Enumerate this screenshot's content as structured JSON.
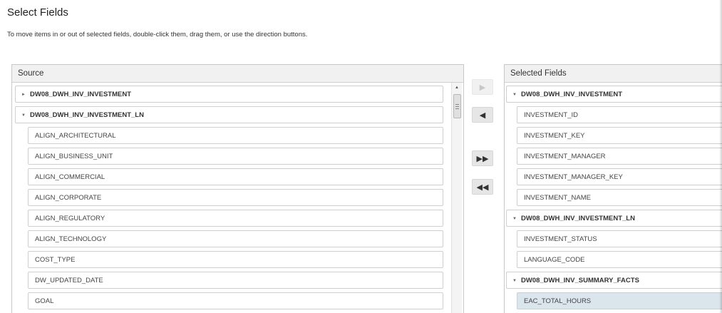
{
  "title": "Select Fields",
  "instructions": "To move items in or out of selected fields, double-click them, drag them, or use the direction buttons.",
  "source": {
    "header": "Source",
    "groups": [
      {
        "label": "DW08_DWH_INV_INVESTMENT",
        "expanded": false
      },
      {
        "label": "DW08_DWH_INV_INVESTMENT_LN",
        "expanded": true
      }
    ],
    "fields": [
      "ALIGN_ARCHITECTURAL",
      "ALIGN_BUSINESS_UNIT",
      "ALIGN_COMMERCIAL",
      "ALIGN_CORPORATE",
      "ALIGN_REGULATORY",
      "ALIGN_TECHNOLOGY",
      "COST_TYPE",
      "DW_UPDATED_DATE",
      "GOAL"
    ]
  },
  "buttons": {
    "move_right": "▶",
    "move_left": "◀",
    "move_all_right": "▶▶",
    "move_all_left": "◀◀"
  },
  "selected": {
    "header": "Selected Fields",
    "group1": "DW08_DWH_INV_INVESTMENT",
    "group1_fields": [
      "INVESTMENT_ID",
      "INVESTMENT_KEY",
      "INVESTMENT_MANAGER",
      "INVESTMENT_MANAGER_KEY",
      "INVESTMENT_NAME"
    ],
    "group2": "DW08_DWH_INV_INVESTMENT_LN",
    "group2_fields": [
      "INVESTMENT_STATUS",
      "LANGUAGE_CODE"
    ],
    "group3": "DW08_DWH_INV_SUMMARY_FACTS",
    "group3_fields": [
      "EAC_TOTAL_HOURS"
    ],
    "highlighted_field": "EAC_TOTAL_HOURS"
  },
  "colors": {
    "highlight": "#dbe6ec",
    "header_bg": "#f1f1f1",
    "button_bg": "#e6e6e6"
  }
}
